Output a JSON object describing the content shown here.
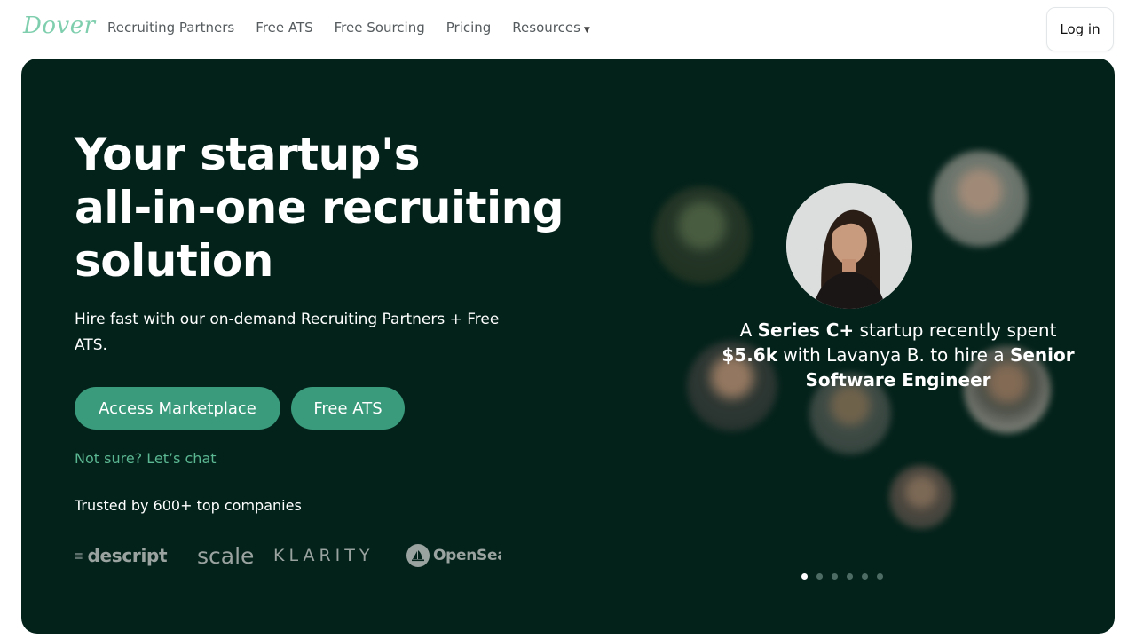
{
  "nav": {
    "logo": "Dover",
    "links": [
      "Recruiting Partners",
      "Free ATS",
      "Free Sourcing",
      "Pricing",
      "Resources"
    ],
    "login_label": "Log in"
  },
  "hero": {
    "headline_lines": [
      "Your startup's",
      "all-in-one recruiting",
      "solution"
    ],
    "subtext": "Hire fast with our on-demand Recruiting Partners + Free ATS.",
    "primary_cta": "Access Marketplace",
    "secondary_cta": "Free ATS",
    "chat_link": "Not sure? Let’s chat",
    "trusted_text": "Trusted by 600+ top companies",
    "companies": [
      "descript",
      "scale",
      "KLARITY",
      "OpenSea"
    ]
  },
  "testimonial": {
    "part1": "A ",
    "stage": "Series C+",
    "part2": " startup recently spent ",
    "amount": "$5.6k",
    "part3": " with Lavanya B. to hire a ",
    "role": "Senior Software Engineer",
    "carousel_total": 6,
    "carousel_active_index": 0
  },
  "colors": {
    "hero_bg": "#03221a",
    "accent": "#3a9b7c",
    "link": "#5bb792",
    "logo": "#7fcfae"
  }
}
